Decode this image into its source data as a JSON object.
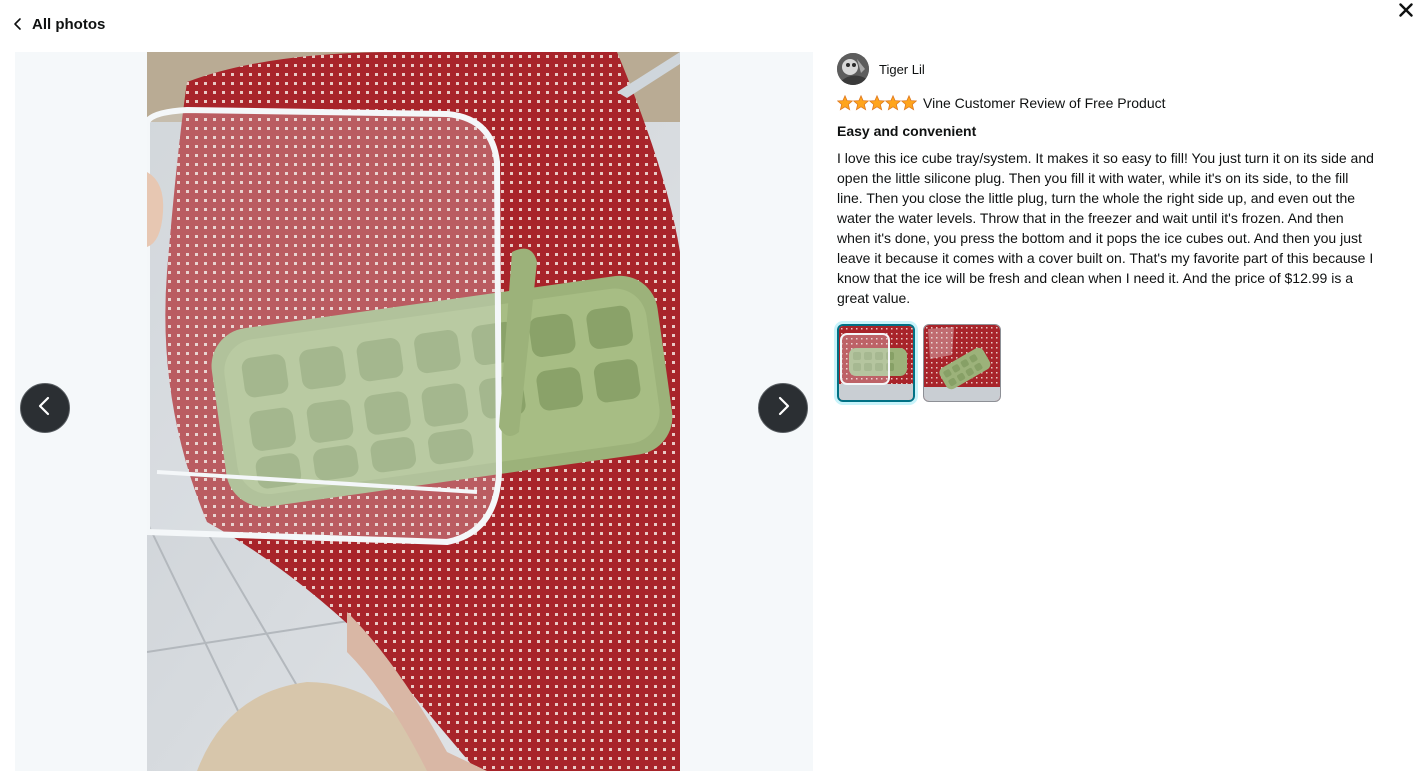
{
  "header": {
    "back_label": "All photos",
    "back_icon": "chevron-left-icon",
    "close_icon": "close-icon"
  },
  "viewer": {
    "prev_icon": "chevron-left-icon",
    "next_icon": "chevron-right-icon"
  },
  "review": {
    "reviewer_name": "Tiger Lil",
    "rating": 5,
    "rating_max": 5,
    "star_color": "#ffa41c",
    "badge_label": "Vine Customer Review of Free Product",
    "title": "Easy and convenient",
    "body": "I love this ice cube tray/system. It makes it so easy to fill! You just turn it on its side and open the little silicone plug. Then you fill it with water, while it's on its side, to the fill line. Then you close the little plug, turn the whole the right side up, and even out the water the water levels. Throw that in the freezer and wait until it's frozen. And then when it's done, you press the bottom and it pops the ice cubes out. And then you just leave it because it comes with a cover built on. That's my favorite part of this because I know that the ice will be fresh and clean when I need it. And the price of $12.99 is a great value."
  },
  "thumbnails": {
    "count": 2,
    "selected_index": 0
  },
  "colors": {
    "selected_border": "#007185",
    "nav_button_bg": "#2b2f33",
    "viewer_bg": "#f5f8fa"
  }
}
